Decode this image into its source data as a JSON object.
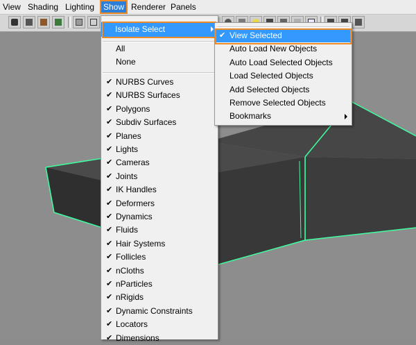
{
  "menubar": {
    "items": [
      {
        "label": "View"
      },
      {
        "label": "Shading"
      },
      {
        "label": "Lighting"
      },
      {
        "label": "Show"
      },
      {
        "label": "Renderer"
      },
      {
        "label": "Panels"
      }
    ],
    "active": "Show"
  },
  "show_menu": {
    "isolate_label": "Isolate Select",
    "all_label": "All",
    "none_label": "None",
    "items": [
      {
        "label": "NURBS Curves",
        "checked": true
      },
      {
        "label": "NURBS Surfaces",
        "checked": true
      },
      {
        "label": "Polygons",
        "checked": true
      },
      {
        "label": "Subdiv Surfaces",
        "checked": true
      },
      {
        "label": "Planes",
        "checked": true
      },
      {
        "label": "Lights",
        "checked": true
      },
      {
        "label": "Cameras",
        "checked": true
      },
      {
        "label": "Joints",
        "checked": true
      },
      {
        "label": "IK Handles",
        "checked": true
      },
      {
        "label": "Deformers",
        "checked": true
      },
      {
        "label": "Dynamics",
        "checked": true
      },
      {
        "label": "Fluids",
        "checked": true
      },
      {
        "label": "Hair Systems",
        "checked": true
      },
      {
        "label": "Follicles",
        "checked": true
      },
      {
        "label": "nCloths",
        "checked": true
      },
      {
        "label": "nParticles",
        "checked": true
      },
      {
        "label": "nRigids",
        "checked": true
      },
      {
        "label": "Dynamic Constraints",
        "checked": true
      },
      {
        "label": "Locators",
        "checked": true
      },
      {
        "label": "Dimensions",
        "checked": true
      }
    ]
  },
  "isolate_submenu": {
    "items": [
      {
        "label": "View Selected",
        "checked": true,
        "highlighted": true
      },
      {
        "label": "Auto Load New Objects",
        "checked": false
      },
      {
        "label": "Auto Load Selected Objects",
        "checked": false
      },
      {
        "label": "Load Selected Objects",
        "checked": false
      },
      {
        "label": "Add Selected Objects",
        "checked": false
      },
      {
        "label": "Remove Selected Objects",
        "checked": false
      },
      {
        "label": "Bookmarks",
        "checked": false,
        "submenu": true
      }
    ]
  },
  "icons": {
    "check": "✔",
    "toolbar": [
      "select-camera-icon",
      "camera-attributes-icon",
      "bookmark-icon",
      "image-plane-icon",
      "grid-icon",
      "wireframe-icon",
      "smooth-shade-icon",
      "textured-icon",
      "lights-icon",
      "shadows-icon",
      "isolate-select-icon",
      "xray-icon",
      "film-gate-icon",
      "resolution-gate-icon"
    ]
  },
  "colors": {
    "highlight": "#3399ff",
    "callout": "#f08a24",
    "wireframe": "#3dffa0",
    "viewport_bg": "#8d8d8d"
  }
}
